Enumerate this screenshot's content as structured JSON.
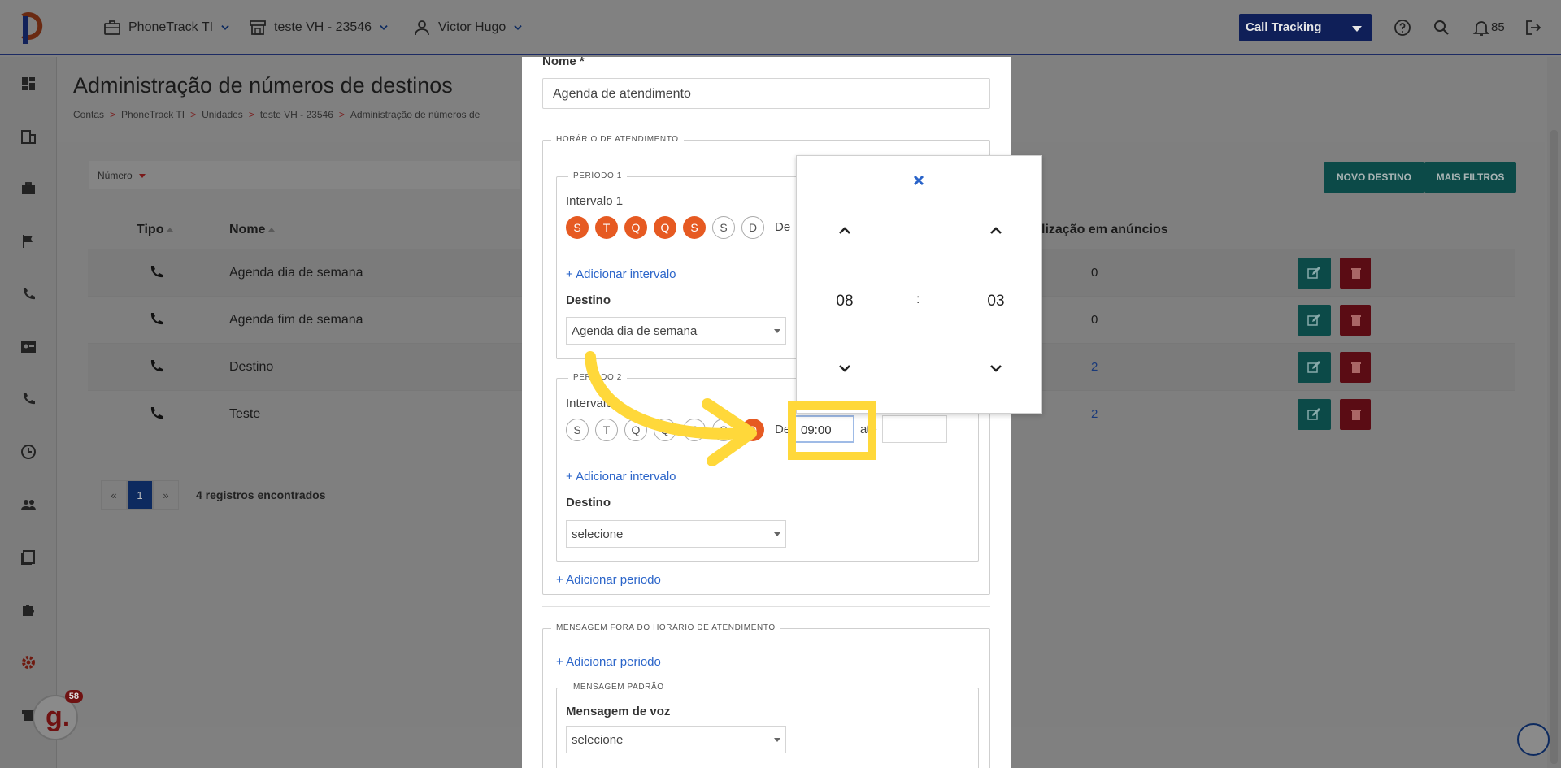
{
  "header": {
    "account": "PhoneTrack TI",
    "unit": "teste VH - 23546",
    "user": "Victor Hugo",
    "product_select": "Call Tracking",
    "notifications_count": "85"
  },
  "page": {
    "title": "Administração de números de destinos",
    "breadcrumb": [
      "Contas",
      "PhoneTrack TI",
      "Unidades",
      "teste VH - 23546",
      "Administração de números de"
    ]
  },
  "filters": {
    "field": "Número",
    "new_button": "NOVO DESTINO",
    "more_filters_button": "MAIS FILTROS"
  },
  "table": {
    "headers": {
      "type": "Tipo",
      "name": "Nome",
      "usage": "lização em anúncios"
    },
    "rows": [
      {
        "name": "Agenda dia de semana",
        "count": "0",
        "link": false
      },
      {
        "name": "Agenda fim de semana",
        "count": "0",
        "link": false
      },
      {
        "name": "Destino",
        "count": "2",
        "link": true
      },
      {
        "name": "Teste",
        "count": "2",
        "link": true
      }
    ]
  },
  "pagination": {
    "prev": "«",
    "current": "1",
    "next": "»",
    "records": "4 registros encontrados"
  },
  "modal": {
    "name_label": "Nome *",
    "name_value": "Agenda de atendimento",
    "schedule_legend": "HORÁRIO DE ATENDIMENTO",
    "period1": {
      "legend": "PERÍODO 1",
      "interval_label": "Intervalo 1",
      "days": [
        "S",
        "T",
        "Q",
        "Q",
        "S",
        "S",
        "D"
      ],
      "days_active": [
        true,
        true,
        true,
        true,
        true,
        false,
        false
      ],
      "from_label": "De",
      "add_interval": "+ Adicionar intervalo",
      "destination_label": "Destino",
      "destination_value": "Agenda dia de semana"
    },
    "period2": {
      "legend": "PERÍODO 2",
      "interval_label": "Intervalo",
      "days": [
        "S",
        "T",
        "Q",
        "Q",
        "S",
        "S",
        "D"
      ],
      "days_active": [
        false,
        false,
        false,
        false,
        false,
        false,
        true
      ],
      "from_label": "De",
      "from_value": "09:00",
      "to_label": "até",
      "add_interval": "+ Adicionar intervalo",
      "destination_label": "Destino",
      "destination_value": "selecione"
    },
    "add_period": "+ Adicionar periodo",
    "off_hours_legend": "MENSAGEM FORA DO HORÁRIO DE ATENDIMENTO",
    "off_hours_add_period": "+ Adicionar periodo",
    "default_msg_legend": "MENSAGEM PADRÃO",
    "voice_label": "Mensagem de voz",
    "voice_value": "selecione"
  },
  "time_picker": {
    "hours": "08",
    "separator": ":",
    "minutes": "03"
  },
  "widgets": {
    "g_badge": "58",
    "g_letter": "g."
  },
  "colors": {
    "accent_orange": "#e65a22",
    "link_blue": "#2a64c9",
    "highlight_yellow": "#ffd83a",
    "navy": "#1c2a63",
    "teal": "#0c4a48",
    "red": "#5a0c14"
  }
}
